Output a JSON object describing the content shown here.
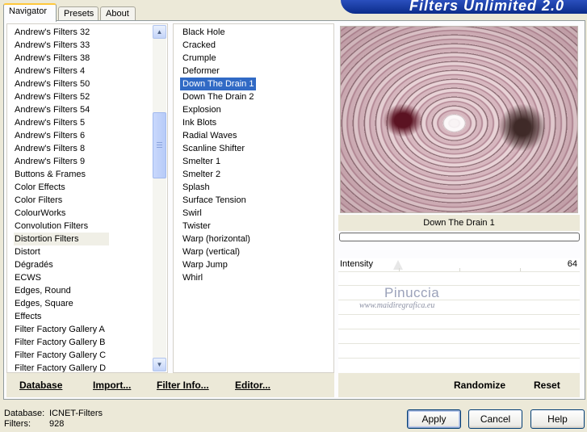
{
  "app": {
    "title": "Filters Unlimited 2.0"
  },
  "tabs": [
    {
      "label": "Navigator",
      "active": true
    },
    {
      "label": "Presets",
      "active": false
    },
    {
      "label": "About",
      "active": false
    }
  ],
  "categories": {
    "items": [
      "Andrew's Filters 32",
      "Andrew's Filters 33",
      "Andrew's Filters 38",
      "Andrew's Filters 4",
      "Andrew's Filters 50",
      "Andrew's Filters 52",
      "Andrew's Filters 54",
      "Andrew's Filters 5",
      "Andrew's Filters 6",
      "Andrew's Filters 8",
      "Andrew's Filters 9",
      "Buttons & Frames",
      "Color Effects",
      "Color Filters",
      "ColourWorks",
      "Convolution Filters",
      "Distortion Filters",
      "Distort",
      "Dégradés",
      "ECWS",
      "Edges, Round",
      "Edges, Square",
      "Effects",
      "Filter Factory Gallery A",
      "Filter Factory Gallery B",
      "Filter Factory Gallery C",
      "Filter Factory Gallery D"
    ],
    "selected": "Distortion Filters"
  },
  "filters": {
    "items": [
      "Black Hole",
      "Cracked",
      "Crumple",
      "Deformer",
      "Down The Drain 1",
      "Down The Drain 2",
      "Explosion",
      "Ink Blots",
      "Radial Waves",
      "Scanline Shifter",
      "Smelter 1",
      "Smelter 2",
      "Splash",
      "Surface Tension",
      "Swirl",
      "Twister",
      "Warp (horizontal)",
      "Warp (vertical)",
      "Warp Jump",
      "Whirl"
    ],
    "selected": "Down The Drain 1"
  },
  "preview": {
    "caption": "Down The Drain 1"
  },
  "params": {
    "intensity_label": "Intensity",
    "intensity_value": "64"
  },
  "watermark": {
    "name": "Pinuccia",
    "url": "www.maidiregrafica.eu"
  },
  "toolbar": {
    "database": "Database",
    "import": "Import...",
    "filter_info": "Filter Info...",
    "editor": "Editor...",
    "randomize": "Randomize",
    "reset": "Reset"
  },
  "status": {
    "database_label": "Database:",
    "database_value": "ICNET-Filters",
    "filters_label": "Filters:",
    "filters_value": "928"
  },
  "buttons": {
    "apply": "Apply",
    "cancel": "Cancel",
    "help": "Help"
  },
  "colors": {
    "selection": "#316ac5",
    "banner": "#0c2c8a",
    "background": "#ece9d8"
  }
}
